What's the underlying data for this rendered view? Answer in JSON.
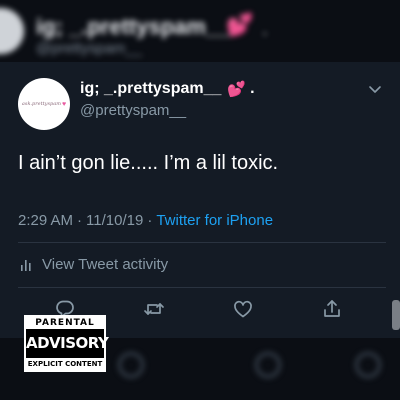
{
  "background_post": {
    "display_name": "ig; _.prettyspam__",
    "handle": "@prettyspam__",
    "emoji": "💕"
  },
  "tweet": {
    "avatar_text": "ask.prettyspam",
    "display_name": "ig; _.prettyspam__",
    "name_emoji": "💕",
    "name_suffix": ".",
    "handle": "@prettyspam__",
    "text": "I ain’t gon lie..... I’m a lil toxic.",
    "time": "2:29 AM",
    "date": "11/10/19",
    "separator": "·",
    "source": "Twitter for iPhone",
    "activity_label": "View Tweet activity"
  },
  "overlay": {
    "advisory_top": "PARENTAL",
    "advisory_middle": "ADVISORY",
    "advisory_bottom": "EXPLICIT CONTENT"
  },
  "colors": {
    "card_background": "#141b25",
    "muted_text": "#8899a6",
    "link": "#1da1f2",
    "heart": "#e85aa0"
  },
  "icons": [
    "caret-down-icon",
    "activity-chart-icon",
    "reply-icon",
    "retweet-icon",
    "like-icon",
    "share-icon"
  ]
}
